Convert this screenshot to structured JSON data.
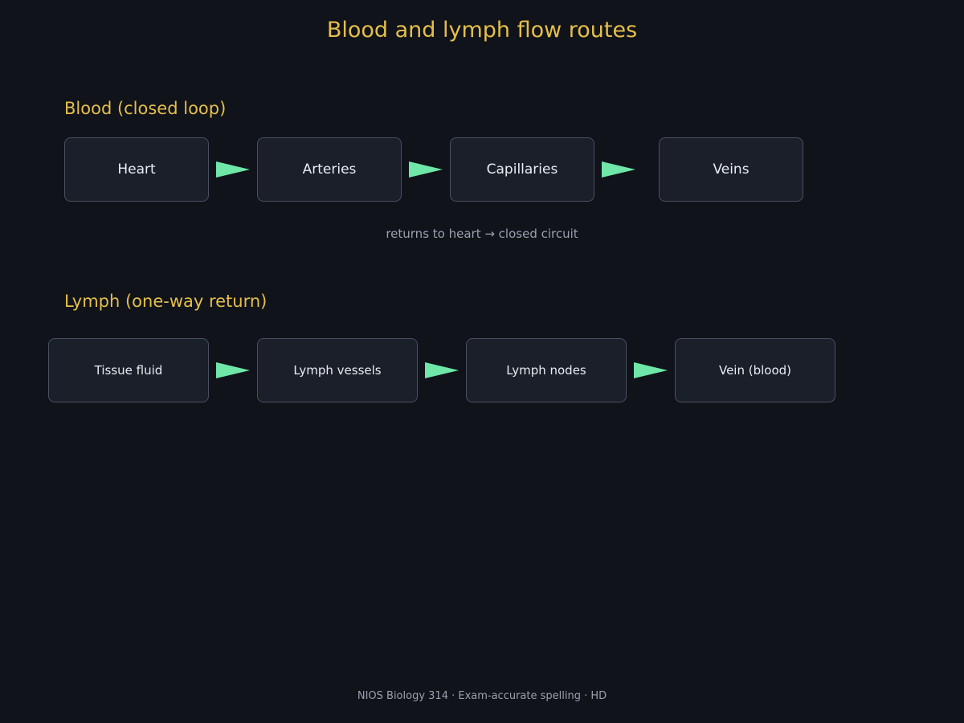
{
  "title": "Blood and lymph flow routes",
  "blood": {
    "heading": "Blood (closed loop)",
    "nodes": [
      "Heart",
      "Arteries",
      "Capillaries",
      "Veins"
    ],
    "note": "returns to heart → closed circuit"
  },
  "lymph": {
    "heading": "Lymph (one-way return)",
    "nodes": [
      "Tissue fluid",
      "Lymph vessels",
      "Lymph nodes",
      "Vein (blood)"
    ]
  },
  "footer": "NIOS Biology 314 · Exam-accurate spelling · HD",
  "colors": {
    "background": "#10131a",
    "heading": "#e6bf4a",
    "node_fill": "#1b1f29",
    "node_border": "#4a5060",
    "arrow": "#6ee7a8",
    "muted_text": "#9aa0ad"
  }
}
